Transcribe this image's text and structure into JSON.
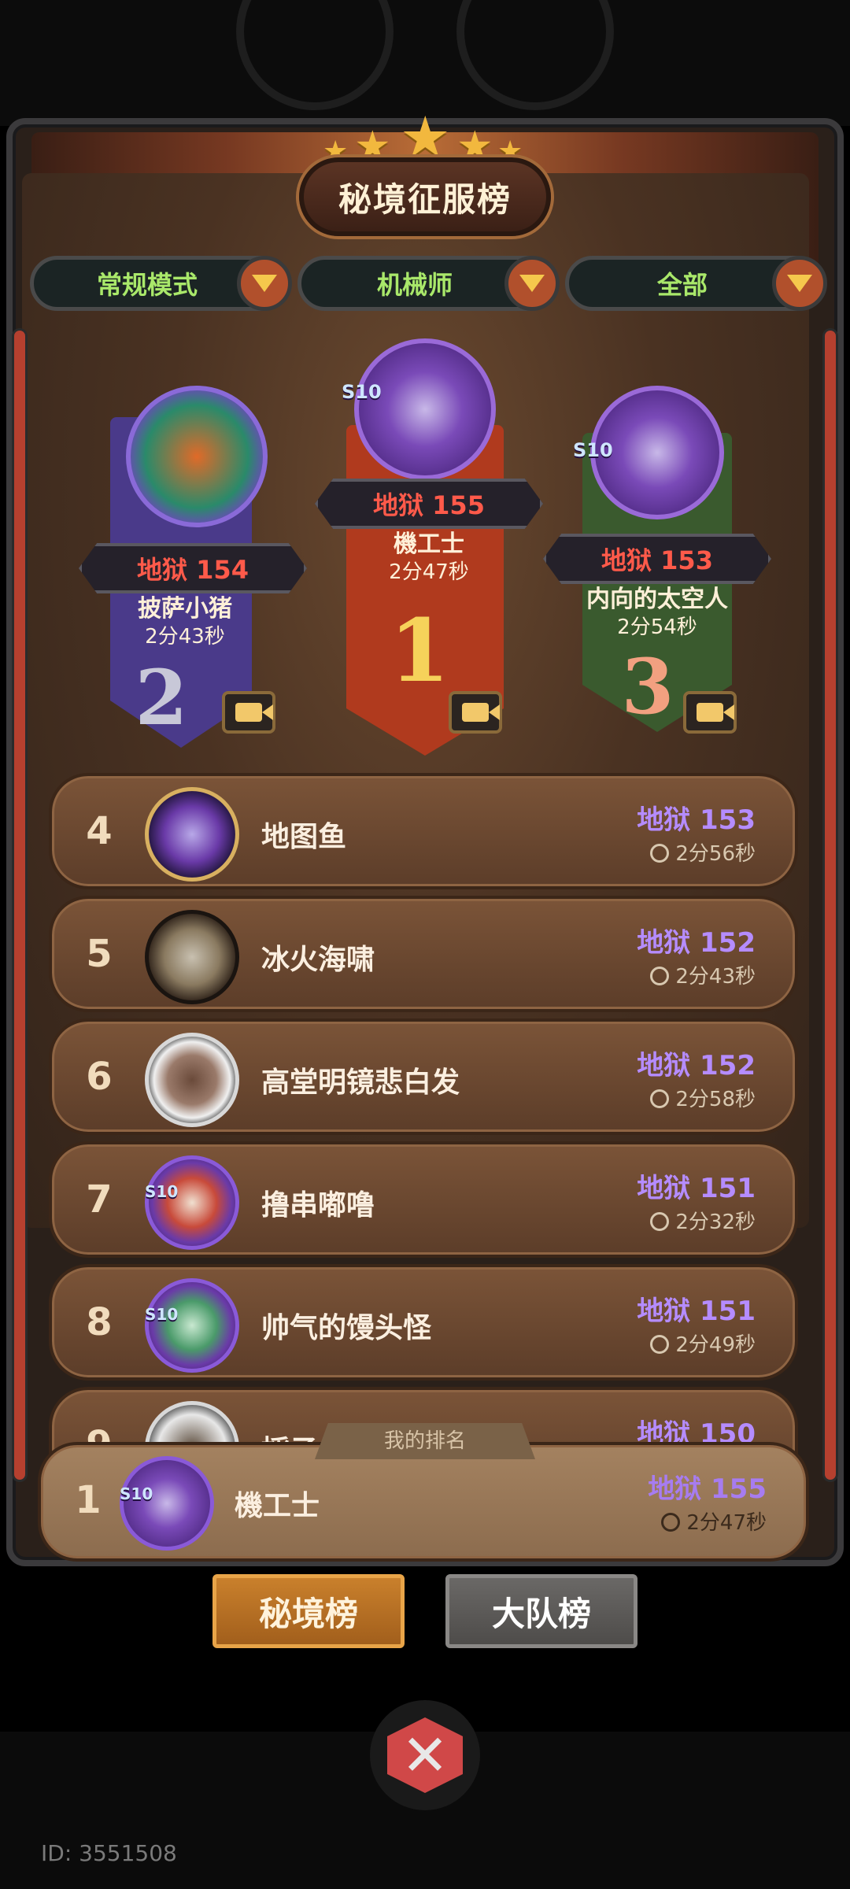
{
  "header": {
    "title": "秘境征服榜"
  },
  "filters": [
    {
      "label": "常规模式"
    },
    {
      "label": "机械师"
    },
    {
      "label": "全部"
    }
  ],
  "podium": [
    {
      "rank": "1",
      "name": "機工士",
      "level": "地狱 155",
      "time": "2分47秒",
      "badge": "S10",
      "card_color": "#b03a1e"
    },
    {
      "rank": "2",
      "name": "披萨小猪",
      "level": "地狱 154",
      "time": "2分43秒",
      "badge": "",
      "card_color": "#4a3a8a"
    },
    {
      "rank": "3",
      "name": "内向的太空人",
      "level": "地狱 153",
      "time": "2分54秒",
      "badge": "S10",
      "card_color": "#3a5a2e"
    }
  ],
  "rows": [
    {
      "rank": "4",
      "name": "地图鱼",
      "level": "地狱 153",
      "time": "2分56秒"
    },
    {
      "rank": "5",
      "name": "冰火海啸",
      "level": "地狱 152",
      "time": "2分43秒"
    },
    {
      "rank": "6",
      "name": "高堂明镜悲白发",
      "level": "地狱 152",
      "time": "2分58秒"
    },
    {
      "rank": "7",
      "name": "撸串嘟噜",
      "level": "地狱 151",
      "time": "2分32秒",
      "badge": "S10"
    },
    {
      "rank": "8",
      "name": "帅气的馒头怪",
      "level": "地狱 151",
      "time": "2分49秒",
      "badge": "S10"
    },
    {
      "rank": "9",
      "name": "採子",
      "level": "地狱 150",
      "time": ""
    }
  ],
  "my_rank": {
    "label": "我的排名",
    "rank": "1",
    "name": "機工士",
    "level": "地狱 155",
    "time": "2分47秒",
    "badge": "S10"
  },
  "tabs": {
    "active": "秘境榜",
    "inactive": "大队榜"
  },
  "footer": {
    "uid": "ID: 3551508"
  },
  "colors": {
    "level_red": "#ff5a4a",
    "level_purple": "#b58cff",
    "filter_green": "#a9e86a",
    "accent_orange": "#c9802c"
  }
}
